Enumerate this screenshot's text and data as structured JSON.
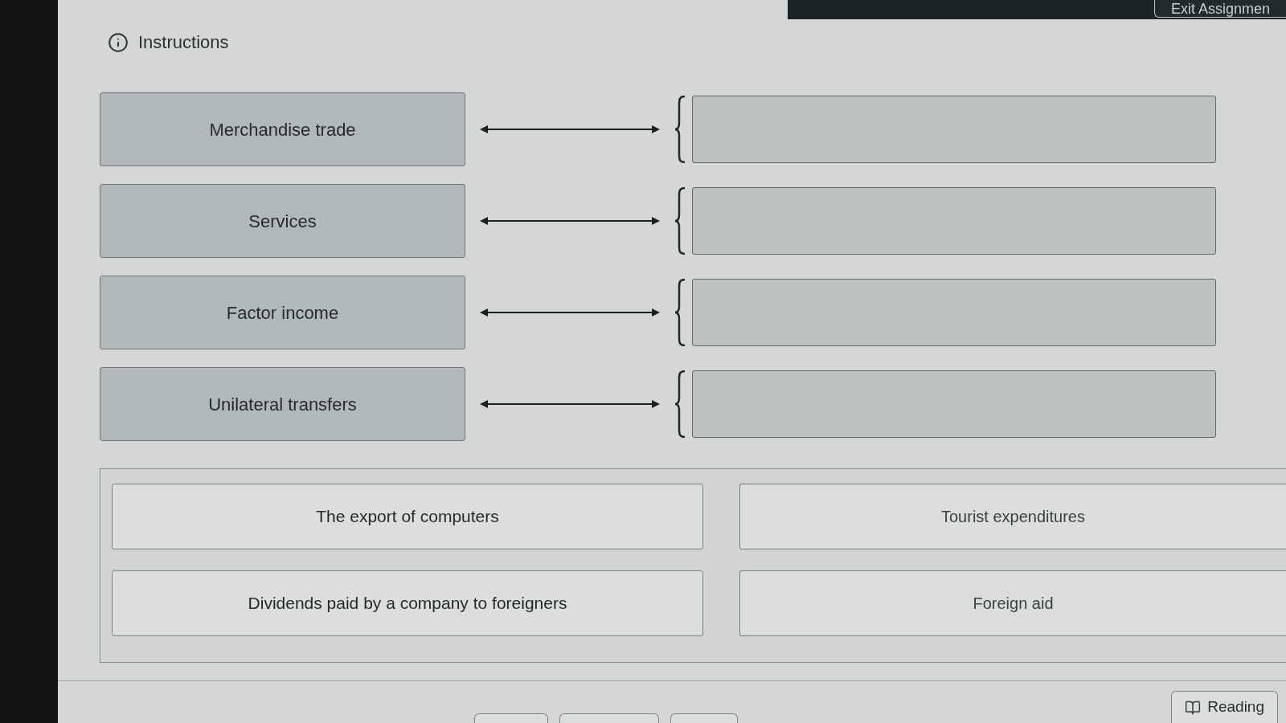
{
  "header": {
    "exit_button": "Exit Assignmen"
  },
  "instructions": {
    "label": "Instructions"
  },
  "matching": {
    "rows": [
      {
        "term": "Merchandise trade"
      },
      {
        "term": "Services"
      },
      {
        "term": "Factor income"
      },
      {
        "term": "Unilateral transfers"
      }
    ]
  },
  "answer_bank": {
    "options": [
      "The export of computers",
      "Tourist expenditures",
      "Dividends paid by a company to foreigners",
      "Foreign aid"
    ]
  },
  "footer": {
    "reading_button": "Reading"
  }
}
